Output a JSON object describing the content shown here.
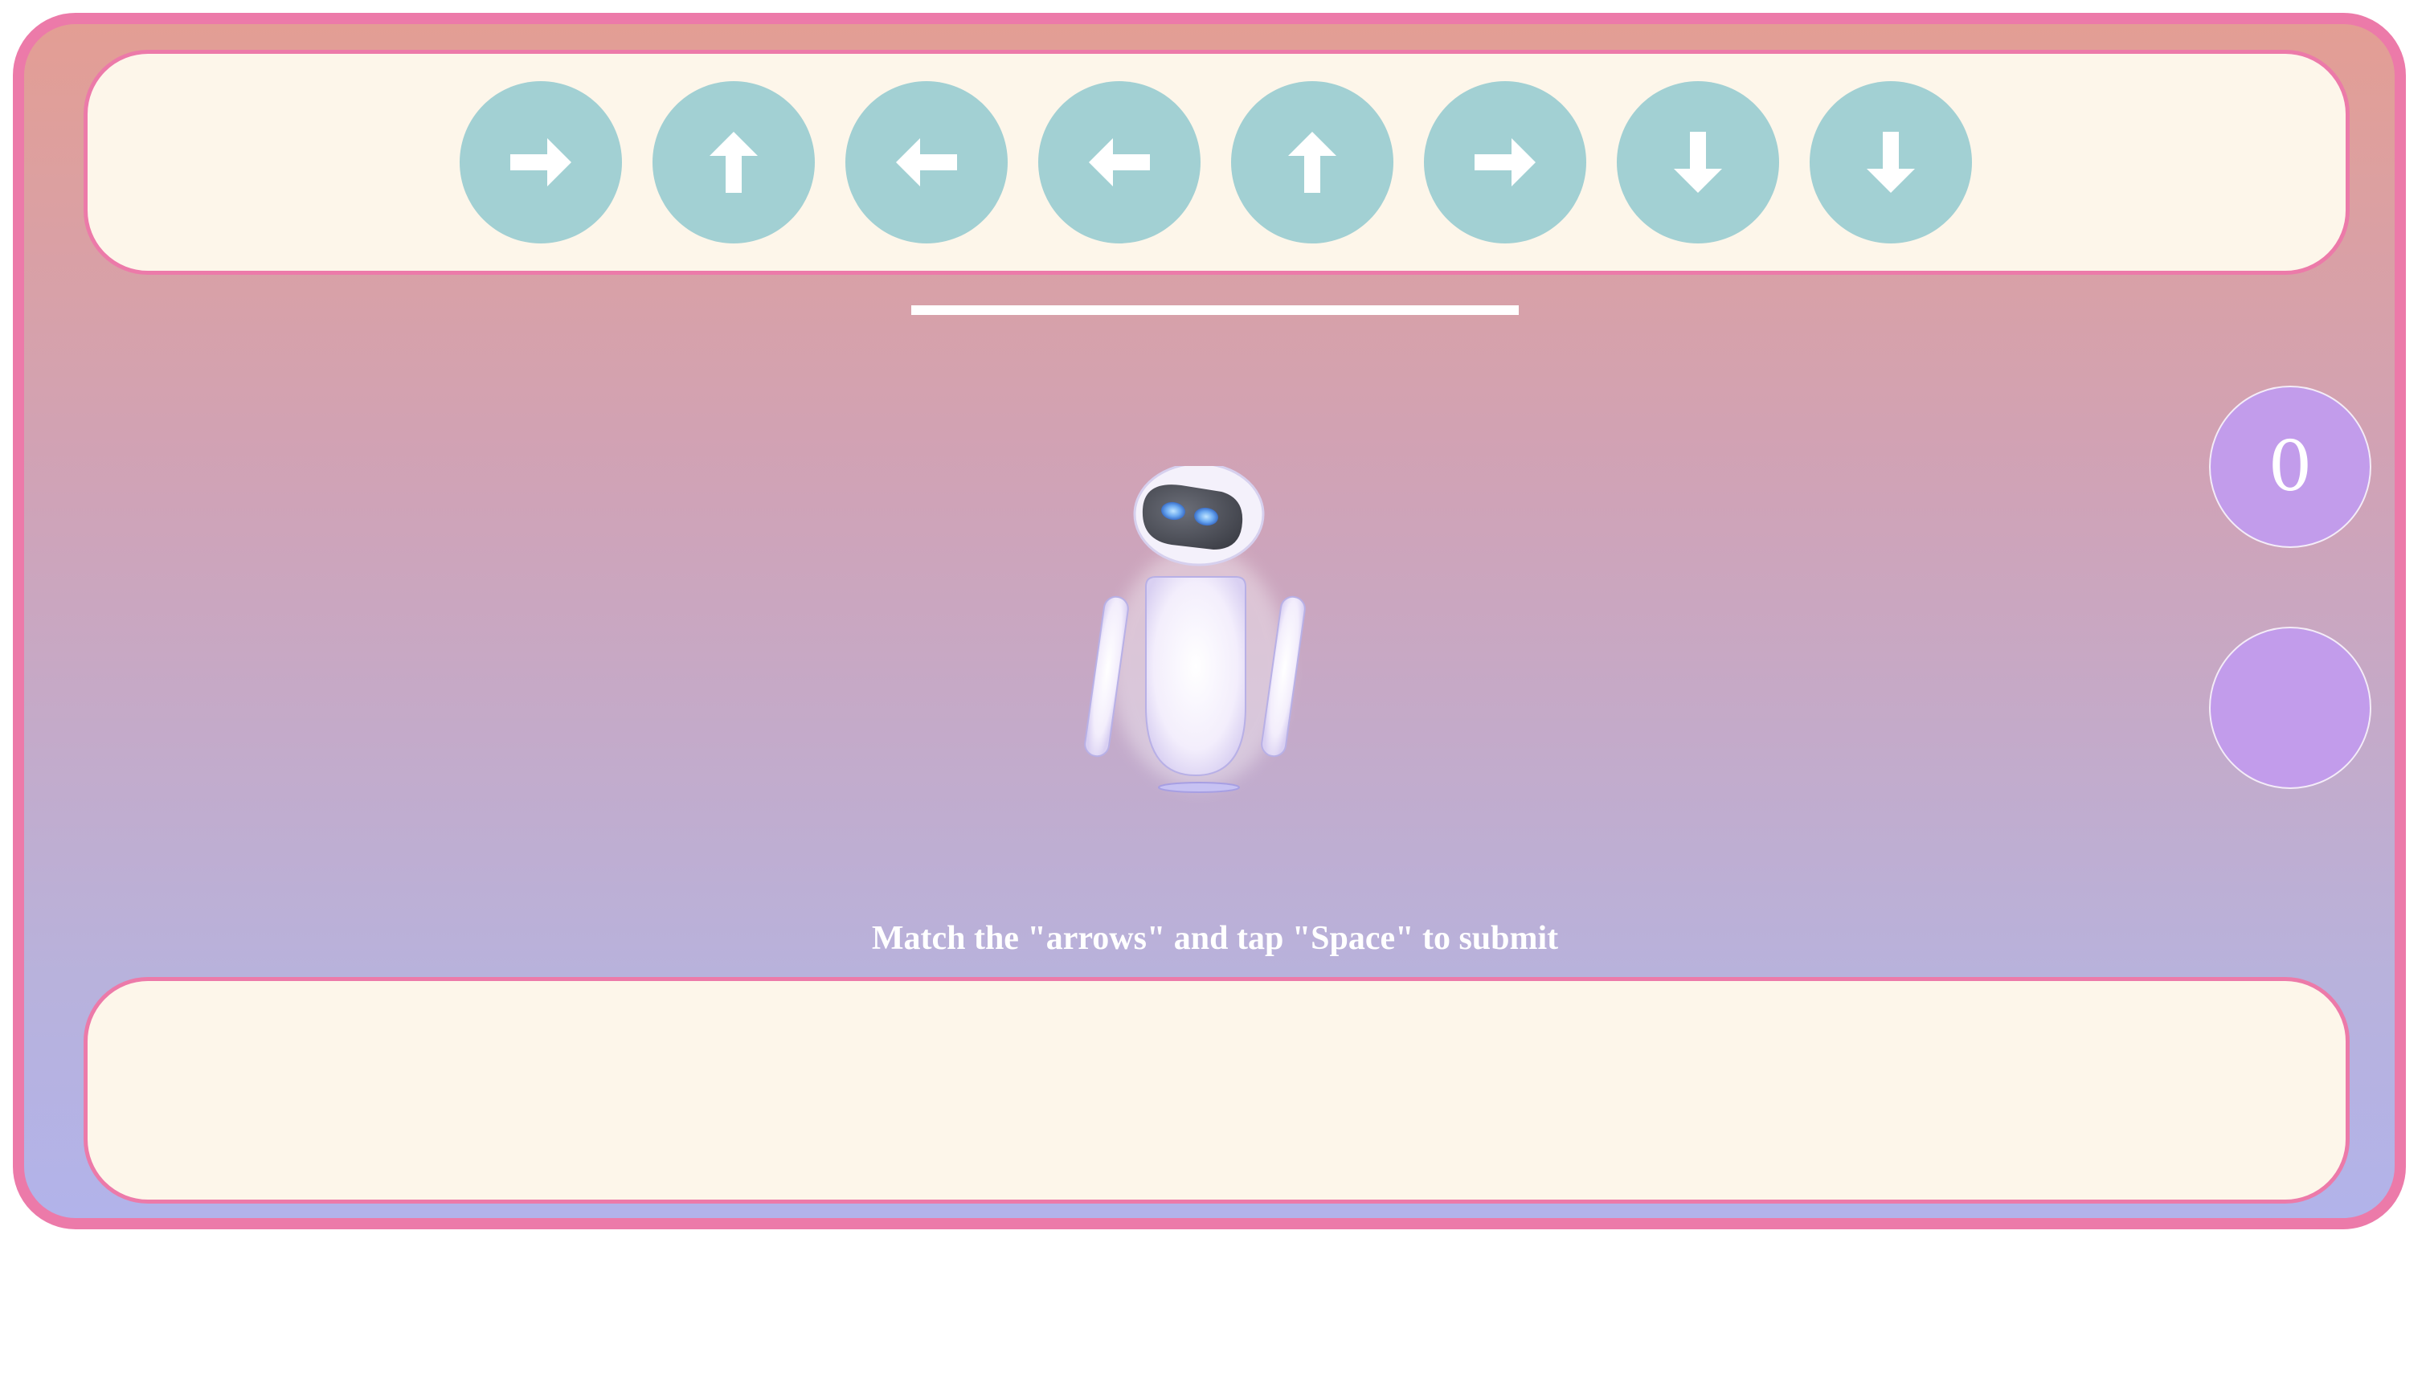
{
  "target_arrows": [
    {
      "direction": "right",
      "icon": "arrow-right-icon"
    },
    {
      "direction": "up",
      "icon": "arrow-up-icon"
    },
    {
      "direction": "left",
      "icon": "arrow-left-icon"
    },
    {
      "direction": "left",
      "icon": "arrow-left-icon"
    },
    {
      "direction": "up",
      "icon": "arrow-up-icon"
    },
    {
      "direction": "right",
      "icon": "arrow-right-icon"
    },
    {
      "direction": "down",
      "icon": "arrow-down-icon"
    },
    {
      "direction": "down",
      "icon": "arrow-down-icon"
    }
  ],
  "input_arrows": [],
  "score": "0",
  "instruction": "Match the \"arrows\" and tap \"Space\" to submit",
  "colors": {
    "frame_border": "#ec7aa9",
    "panel_background": "#fdf6ea",
    "arrow_button": "#a2d0d3",
    "side_circle": "#c29ceb",
    "gradient_top": "#e39e94",
    "gradient_bottom": "#b2b3ea"
  }
}
